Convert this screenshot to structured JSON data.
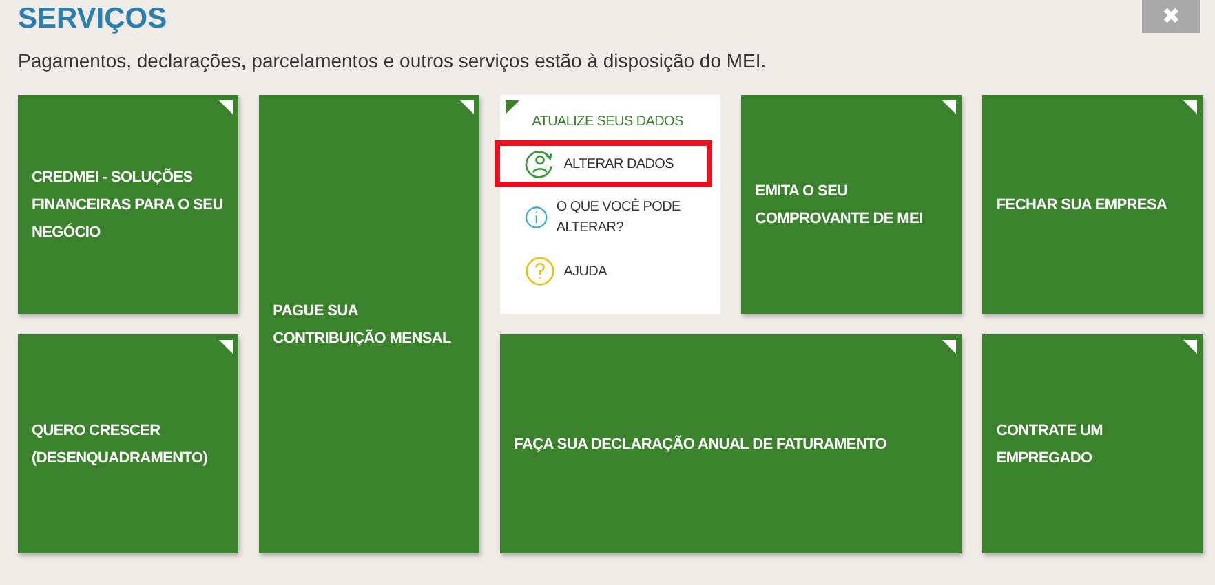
{
  "header": {
    "title": "SERVIÇOS",
    "subtitle": "Pagamentos, declarações, parcelamentos e outros serviços estão à disposição do MEI.",
    "close": "✖"
  },
  "tiles": [
    {
      "kind": "square",
      "label": "CREDMEI - SOLUÇÕES FINANCEIRAS PARA O SEU NEGÓCIO"
    },
    {
      "kind": "tall",
      "label": "PAGUE SUA CONTRIBUIÇÃO MENSAL"
    },
    {
      "kind": "panel",
      "title": "ATUALIZE SEUS DADOS",
      "items": [
        {
          "kind": "person",
          "label": "ALTERAR DADOS",
          "selected": true
        },
        {
          "kind": "info",
          "label": "O QUE VOCÊ PODE ALTERAR?",
          "selected": false
        },
        {
          "kind": "help",
          "label": "AJUDA",
          "selected": false
        }
      ]
    },
    {
      "kind": "square",
      "label": "EMITA O SEU COMPROVANTE DE MEI"
    },
    {
      "kind": "square",
      "label": "FECHAR SUA EMPRESA"
    },
    {
      "kind": "square",
      "label": "QUERO CRESCER (DESENQUADRAMENTO)"
    },
    {
      "kind": "wide",
      "label": "FAÇA SUA DECLARAÇÃO ANUAL DE FATURAMENTO"
    },
    {
      "kind": "square",
      "label": "CONTRATE UM EMPREGADO"
    }
  ]
}
